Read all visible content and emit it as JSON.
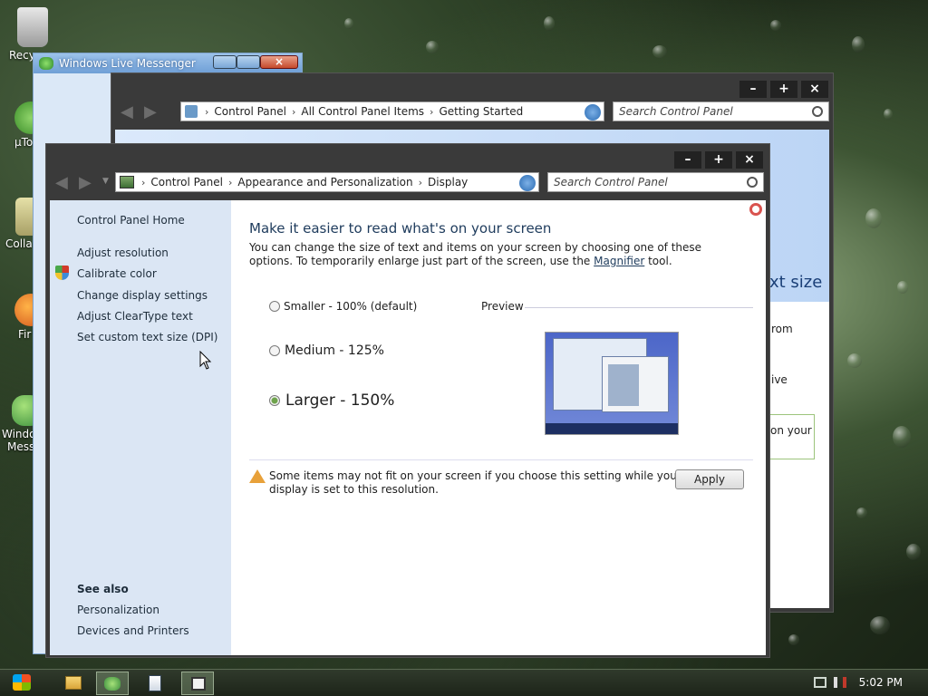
{
  "desktop": {
    "icons": [
      {
        "label": "Recy"
      },
      {
        "label": "µTo"
      },
      {
        "label": "Colla"
      },
      {
        "label": "Fir"
      },
      {
        "label": "Windo"
      },
      {
        "label": "Messe"
      }
    ]
  },
  "messenger": {
    "title": "Windows Live Messenger"
  },
  "getting_started": {
    "breadcrumbs": [
      "Control Panel",
      "All Control Panel Items",
      "Getting Started"
    ],
    "search_placeholder": "Search Control Panel",
    "behind_text": {
      "heading_fragment": "xt size",
      "line1": "rom",
      "line2": "ive",
      "line3": "on your"
    }
  },
  "display": {
    "breadcrumbs": [
      "Control Panel",
      "Appearance and Personalization",
      "Display"
    ],
    "search_placeholder": "Search Control Panel",
    "sidebar": {
      "home": "Control Panel Home",
      "links": [
        "Adjust resolution",
        "Calibrate color",
        "Change display settings",
        "Adjust ClearType text",
        "Set custom text size (DPI)"
      ],
      "see_also_heading": "See also",
      "see_also": [
        "Personalization",
        "Devices and Printers"
      ]
    },
    "main": {
      "title": "Make it easier to read what's on your screen",
      "desc_part1": "You can change the size of text and items on your screen by choosing one of these options. To temporarily enlarge just part of the screen, use the ",
      "desc_link": "Magnifier",
      "desc_part2": " tool.",
      "options": [
        {
          "label": "Smaller - 100% (default)",
          "selected": false
        },
        {
          "label": "Medium - 125%",
          "selected": false
        },
        {
          "label": "Larger - 150%",
          "selected": true
        }
      ],
      "preview_label": "Preview",
      "warning": "Some items may not fit on your screen if you choose this setting while your display is set to this resolution.",
      "apply_label": "Apply"
    }
  },
  "taskbar": {
    "clock": "5:02 PM"
  }
}
